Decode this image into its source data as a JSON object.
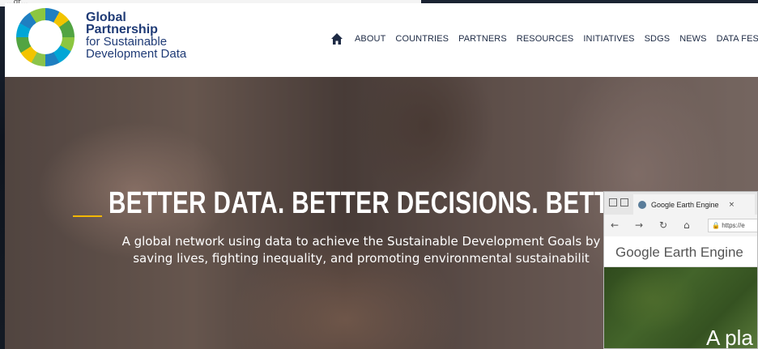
{
  "background_window": {
    "fragment": "...dt..."
  },
  "site": {
    "logo": {
      "line1": "Global",
      "line2": "Partnership",
      "line3": "for Sustainable",
      "line4": "Development Data"
    },
    "nav": {
      "home_icon": "home-icon",
      "items": [
        "ABOUT",
        "COUNTRIES",
        "PARTNERS",
        "RESOURCES",
        "INITIATIVES",
        "SDGS",
        "NEWS",
        "DATA FEST"
      ],
      "search_icon": "search-icon",
      "color": "#1d2a44",
      "search_color": "#1f7fc1"
    },
    "hero": {
      "title": "BETTER DATA. BETTER DECISIONS. BETTER L",
      "subtitle": "A global network using data to achieve the Sustainable Development Goals by saving lives, fighting inequality, and promoting environmental sustainabilit",
      "accent_color": "#f2b705"
    }
  },
  "edge_window": {
    "tab_title": "Google Earth Engine",
    "tab_close": "×",
    "nav_back": "←",
    "nav_forward": "→",
    "nav_refresh": "↻",
    "nav_home": "⌂",
    "url": "https://e",
    "brand_google": "Google",
    "brand_product": "Earth Engine",
    "content_text": "A pla"
  }
}
